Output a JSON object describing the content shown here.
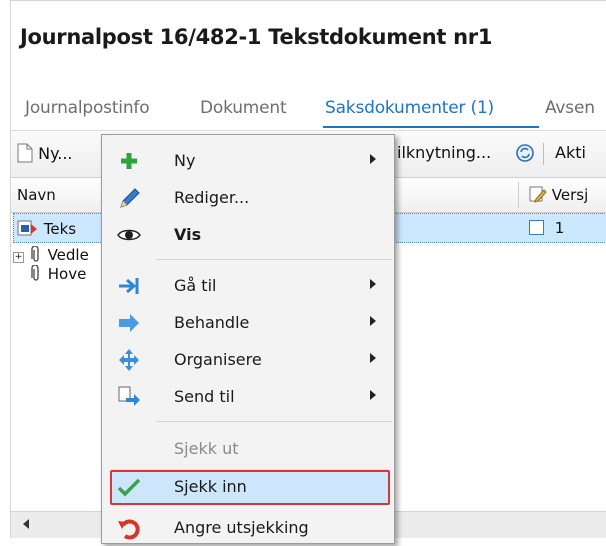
{
  "window": {
    "title": "Journalpost 16/482-1 Tekstdokument nr1"
  },
  "tabs": [
    {
      "label": "Journalpostinfo",
      "active": false
    },
    {
      "label": "Dokument",
      "active": false
    },
    {
      "label": "Saksdokumenter (1)",
      "active": true
    },
    {
      "label": "Avsen",
      "active": false
    }
  ],
  "toolbar": {
    "new_label": "Ny...",
    "link_label": "ilknytning...",
    "action_label": "Akti"
  },
  "list": {
    "columns": [
      "Navn",
      "Versj"
    ],
    "rows": [
      {
        "name": "Teks",
        "version": "1",
        "selected": true
      },
      {
        "name": "Vedle"
      },
      {
        "name": "Hove"
      }
    ]
  },
  "context_menu": {
    "items": [
      {
        "label": "Ny",
        "icon": "plus-icon",
        "submenu": true
      },
      {
        "label": "Rediger...",
        "icon": "pencil-icon",
        "submenu": false
      },
      {
        "label": "Vis",
        "icon": "eye-icon",
        "submenu": false,
        "bold": true
      },
      {
        "label": "Gå til",
        "icon": "goto-arrow-icon",
        "submenu": true
      },
      {
        "label": "Behandle",
        "icon": "process-arrow-icon",
        "submenu": true
      },
      {
        "label": "Organisere",
        "icon": "move-icon",
        "submenu": true
      },
      {
        "label": "Send til",
        "icon": "send-icon",
        "submenu": true
      },
      {
        "label": "Sjekk ut",
        "icon": "",
        "submenu": false,
        "disabled": true
      },
      {
        "label": "Sjekk inn",
        "icon": "checkmark-icon",
        "submenu": false,
        "highlighted": true
      },
      {
        "label": "Angre utsjekking",
        "icon": "undo-icon",
        "submenu": false
      }
    ]
  },
  "colors": {
    "accent": "#1f74c3",
    "highlight_frame": "#d23a3a",
    "selection": "#cce8ff"
  }
}
